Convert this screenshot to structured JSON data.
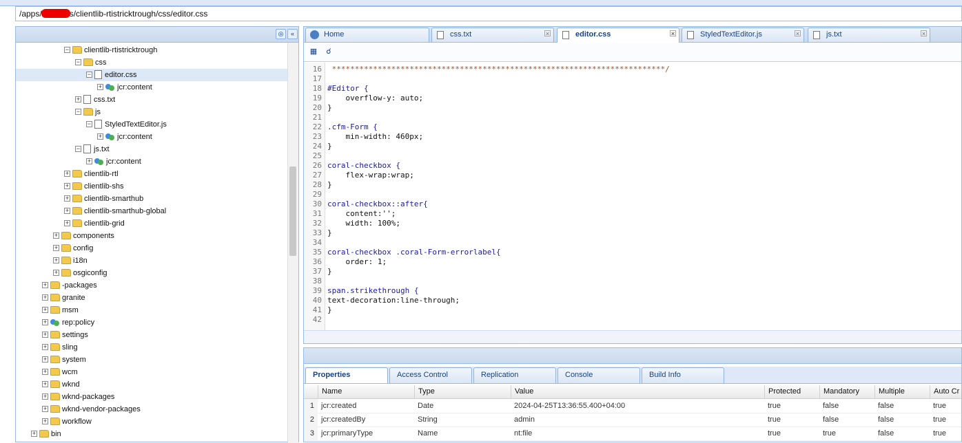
{
  "address": {
    "path": "/apps/clientlibs/clientlib-rtistricktrough/css/editor.css"
  },
  "tree": {
    "items": [
      {
        "label": "clientlib-rtistricktrough",
        "kind": "folder",
        "exp": "−"
      },
      {
        "label": "css",
        "kind": "folder",
        "exp": "−"
      },
      {
        "label": "editor.css",
        "kind": "file",
        "exp": "−",
        "selected": true
      },
      {
        "label": "jcr:content",
        "kind": "node",
        "exp": "+"
      },
      {
        "label": "css.txt",
        "kind": "file",
        "exp": "+"
      },
      {
        "label": "js",
        "kind": "folder",
        "exp": "−"
      },
      {
        "label": "StyledTextEditor.js",
        "kind": "file",
        "exp": "−"
      },
      {
        "label": "jcr:content",
        "kind": "node",
        "exp": "+"
      },
      {
        "label": "js.txt",
        "kind": "file",
        "exp": "−"
      },
      {
        "label": "jcr:content",
        "kind": "node",
        "exp": "+"
      },
      {
        "label": "clientlib-rtl",
        "kind": "folder",
        "exp": "+"
      },
      {
        "label": "clientlib-shs",
        "kind": "folder",
        "exp": "+"
      },
      {
        "label": "clientlib-smarthub",
        "kind": "folder",
        "exp": "+"
      },
      {
        "label": "clientlib-smarthub-global",
        "kind": "folder",
        "exp": "+"
      },
      {
        "label": "clientlib-grid",
        "kind": "folder",
        "exp": "+"
      },
      {
        "label": "components",
        "kind": "folder",
        "exp": "+"
      },
      {
        "label": "config",
        "kind": "folder",
        "exp": "+"
      },
      {
        "label": "i18n",
        "kind": "folder",
        "exp": "+"
      },
      {
        "label": "osgiconfig",
        "kind": "folder",
        "exp": "+"
      },
      {
        "label": "-packages",
        "kind": "folder",
        "exp": "+"
      },
      {
        "label": "granite",
        "kind": "folder",
        "exp": "+"
      },
      {
        "label": "msm",
        "kind": "folder",
        "exp": "+"
      },
      {
        "label": "rep:policy",
        "kind": "node",
        "exp": "+"
      },
      {
        "label": "settings",
        "kind": "folder",
        "exp": "+"
      },
      {
        "label": "sling",
        "kind": "folder",
        "exp": "+"
      },
      {
        "label": "system",
        "kind": "folder",
        "exp": "+"
      },
      {
        "label": "wcm",
        "kind": "folder",
        "exp": "+"
      },
      {
        "label": "wknd",
        "kind": "folder",
        "exp": "+"
      },
      {
        "label": "wknd-packages",
        "kind": "folder",
        "exp": "+"
      },
      {
        "label": "wknd-vendor-packages",
        "kind": "folder",
        "exp": "+"
      },
      {
        "label": "workflow",
        "kind": "folder",
        "exp": "+"
      },
      {
        "label": "bin",
        "kind": "folder",
        "exp": "+"
      }
    ]
  },
  "editor": {
    "tabs": [
      {
        "label": "Home",
        "closable": false,
        "active": false
      },
      {
        "label": "css.txt",
        "closable": true,
        "active": false
      },
      {
        "label": "editor.css",
        "closable": true,
        "active": true
      },
      {
        "label": "StyledTextEditor.js",
        "closable": true,
        "active": false
      },
      {
        "label": "js.txt",
        "closable": true,
        "active": false
      }
    ],
    "lines": [
      {
        "n": "16",
        "text": " *************************************************************************/",
        "cls": "cmt"
      },
      {
        "n": "17",
        "text": "",
        "cls": "prop"
      },
      {
        "n": "18",
        "text": "#Editor {",
        "cls": "sel"
      },
      {
        "n": "19",
        "text": "    overflow-y: auto;",
        "cls": "prop"
      },
      {
        "n": "20",
        "text": "}",
        "cls": "prop"
      },
      {
        "n": "21",
        "text": "",
        "cls": "prop"
      },
      {
        "n": "22",
        "text": ".cfm-Form {",
        "cls": "sel"
      },
      {
        "n": "23",
        "text": "    min-width: 460px;",
        "cls": "prop"
      },
      {
        "n": "24",
        "text": "}",
        "cls": "prop"
      },
      {
        "n": "25",
        "text": "",
        "cls": "prop"
      },
      {
        "n": "26",
        "text": "coral-checkbox {",
        "cls": "sel"
      },
      {
        "n": "27",
        "text": "    flex-wrap:wrap;",
        "cls": "prop"
      },
      {
        "n": "28",
        "text": "}",
        "cls": "prop"
      },
      {
        "n": "29",
        "text": "",
        "cls": "prop"
      },
      {
        "n": "30",
        "text": "coral-checkbox::after{",
        "cls": "sel"
      },
      {
        "n": "31",
        "text": "    content:'';",
        "cls": "prop"
      },
      {
        "n": "32",
        "text": "    width: 100%;",
        "cls": "prop"
      },
      {
        "n": "33",
        "text": "}",
        "cls": "prop"
      },
      {
        "n": "34",
        "text": "",
        "cls": "prop"
      },
      {
        "n": "35",
        "text": "coral-checkbox .coral-Form-errorlabel{",
        "cls": "sel"
      },
      {
        "n": "36",
        "text": "    order: 1;",
        "cls": "prop"
      },
      {
        "n": "37",
        "text": "}",
        "cls": "prop"
      },
      {
        "n": "38",
        "text": "",
        "cls": "prop"
      },
      {
        "n": "39",
        "text": "span.strikethrough {",
        "cls": "sel"
      },
      {
        "n": "40",
        "text": "text-decoration:line-through;",
        "cls": "prop"
      },
      {
        "n": "41",
        "text": "}",
        "cls": "prop"
      },
      {
        "n": "42",
        "text": "",
        "cls": "prop"
      }
    ]
  },
  "properties": {
    "tabs": [
      "Properties",
      "Access Control",
      "Replication",
      "Console",
      "Build Info"
    ],
    "columns": [
      "Name",
      "Type",
      "Value",
      "Protected",
      "Mandatory",
      "Multiple",
      "Auto Cr"
    ],
    "rows": [
      {
        "n": "1",
        "name": "jcr:created",
        "type": "Date",
        "value": "2024-04-25T13:36:55.400+04:00",
        "protected": "true",
        "mandatory": "false",
        "multiple": "false",
        "auto": "true"
      },
      {
        "n": "2",
        "name": "jcr:createdBy",
        "type": "String",
        "value": "admin",
        "protected": "true",
        "mandatory": "false",
        "multiple": "false",
        "auto": "true"
      },
      {
        "n": "3",
        "name": "jcr:primaryType",
        "type": "Name",
        "value": "nt:file",
        "protected": "true",
        "mandatory": "true",
        "multiple": "false",
        "auto": "true"
      }
    ]
  }
}
